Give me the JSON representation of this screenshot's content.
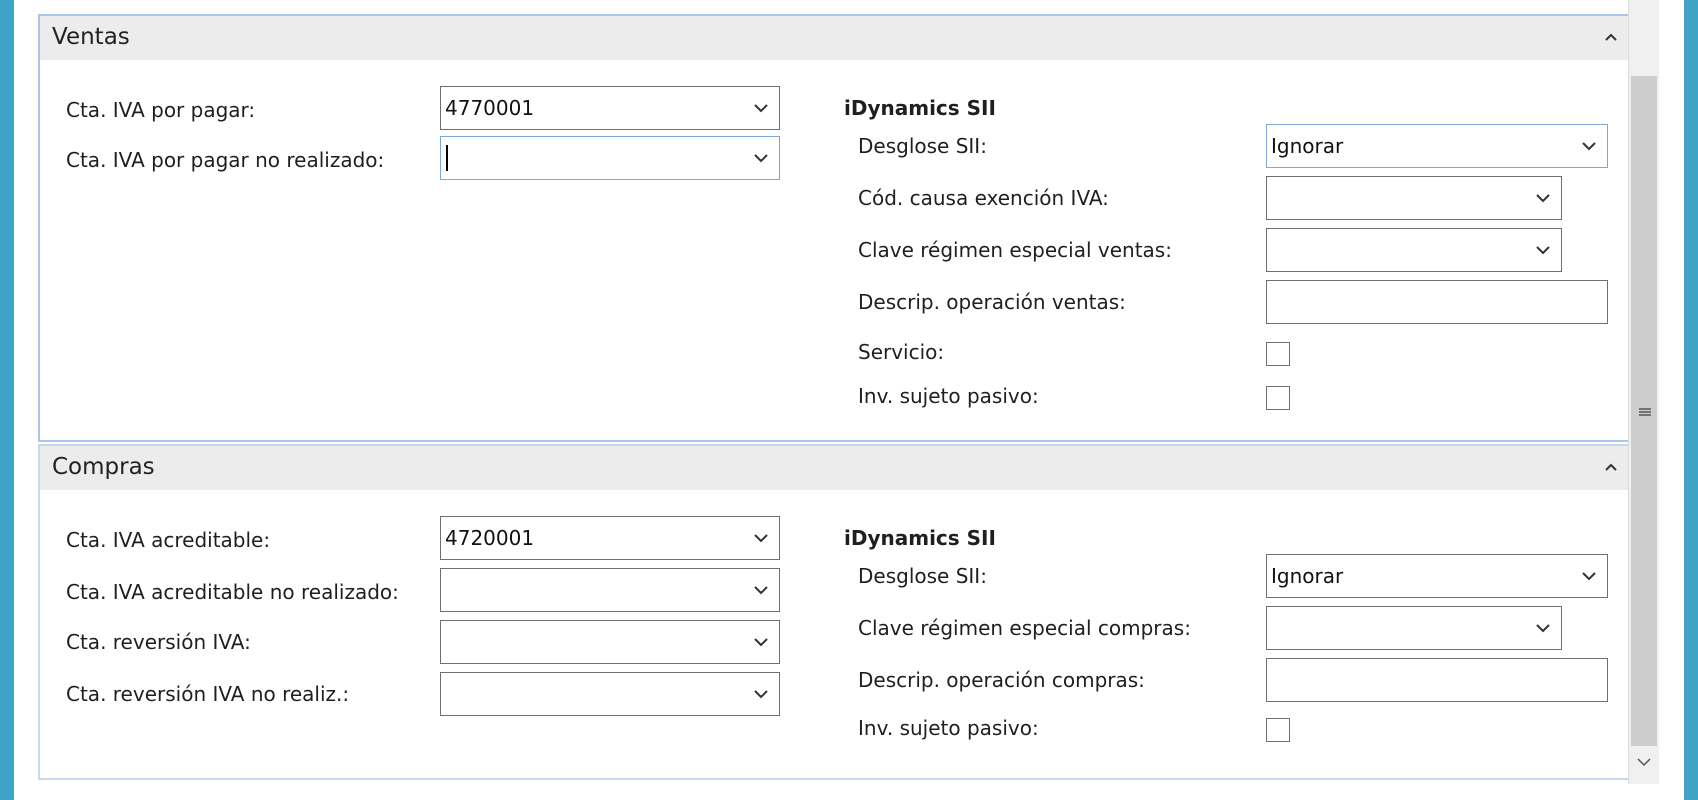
{
  "ventas": {
    "title": "Ventas",
    "left_fields": [
      {
        "label": "Cta. IVA por pagar:",
        "value": "4770001"
      },
      {
        "label": "Cta. IVA por pagar no realizado:",
        "value": ""
      }
    ],
    "right_group_title": "iDynamics SII",
    "right_fields": {
      "desglose_label": "Desglose SII:",
      "desglose_value": "Ignorar",
      "causa_label": "Cód. causa exención IVA:",
      "causa_value": "",
      "clave_label": "Clave régimen especial ventas:",
      "clave_value": "",
      "descrip_label": "Descrip. operación ventas:",
      "descrip_value": "",
      "servicio_label": "Servicio:",
      "inv_label": "Inv. sujeto pasivo:"
    }
  },
  "compras": {
    "title": "Compras",
    "left_fields": [
      {
        "label": "Cta. IVA acreditable:",
        "value": "4720001"
      },
      {
        "label": "Cta. IVA acreditable no realizado:",
        "value": ""
      },
      {
        "label": "Cta. reversión IVA:",
        "value": ""
      },
      {
        "label": "Cta. reversión IVA no realiz.:",
        "value": ""
      }
    ],
    "right_group_title": "iDynamics SII",
    "right_fields": {
      "desglose_label": "Desglose SII:",
      "desglose_value": "Ignorar",
      "clave_label": "Clave régimen especial compras:",
      "clave_value": "",
      "descrip_label": "Descrip. operación compras:",
      "descrip_value": "",
      "inv_label": "Inv. sujeto pasivo:"
    }
  },
  "icons": {
    "collapse": "chevron-up-icon",
    "dropdown": "chevron-down-icon",
    "scroll_grip": "grip-icon",
    "scroll_down": "chevron-down-icon"
  },
  "colors": {
    "window_accent": "#3ea3c6",
    "section_border": "#a9c7ec",
    "header_bg": "#ececec"
  }
}
